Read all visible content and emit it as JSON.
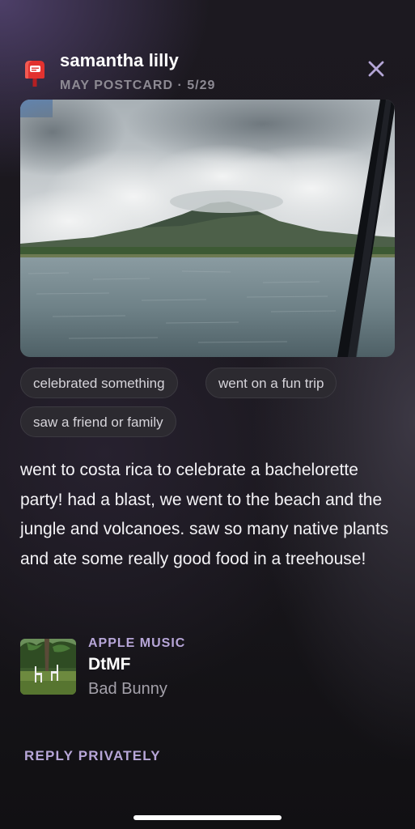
{
  "header": {
    "sender_name": "samantha lilly",
    "postcard_meta": "MAY POSTCARD · 5/29",
    "mailbox_icon": "mailbox-icon",
    "close_icon": "close-icon"
  },
  "photo": {
    "subject": "lake-and-volcano-photo"
  },
  "tags": [
    "celebrated something",
    "went on a fun trip",
    "saw a friend or family"
  ],
  "message": "went to costa rica to celebrate a bachelorette party! had a blast, we went to the beach and the jungle and volcanoes. saw so many native plants and ate some really good food in a treehouse!",
  "music": {
    "service": "APPLE MUSIC",
    "title": "DtMF",
    "artist": "Bad Bunny"
  },
  "actions": {
    "reply_label": "REPLY PRIVATELY"
  },
  "colors": {
    "accent": "#b7a6d8",
    "mailbox_red": "#d9292b",
    "tag_bg": "#2c2a30"
  }
}
